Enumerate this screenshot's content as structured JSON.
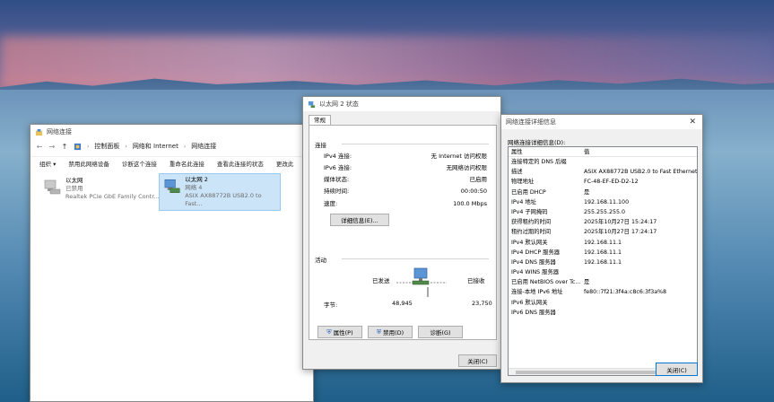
{
  "explorer": {
    "title": "网络连接",
    "breadcrumb": [
      "控制面板",
      "网络和 Internet",
      "网络连接"
    ],
    "toolbar": [
      "组织 ▾",
      "禁用此网络设备",
      "诊断这个连接",
      "重命名此连接",
      "查看此连接的状态",
      "更改此"
    ],
    "adapters": [
      {
        "name": "以太网",
        "status": "已禁用",
        "device": "Realtek PCIe GbE Family Contr..."
      },
      {
        "name": "以太网 2",
        "status": "网络 4",
        "device": "ASIX AX88772B USB2.0 to Fast..."
      }
    ]
  },
  "status_dialog": {
    "title": "以太网 2 状态",
    "tab": "常规",
    "connection_label": "连接",
    "rows": [
      {
        "label": "IPv4 连接:",
        "value": "无 Internet 访问权限"
      },
      {
        "label": "IPv6 连接:",
        "value": "无网络访问权限"
      },
      {
        "label": "媒体状态:",
        "value": "已启用"
      },
      {
        "label": "持续时间:",
        "value": "00:00:50"
      },
      {
        "label": "速度:",
        "value": "100.0 Mbps"
      }
    ],
    "details_button": "详细信息(E)...",
    "activity_label": "活动",
    "sent_label": "已发送",
    "received_label": "已接收",
    "bytes_label": "字节:",
    "bytes_sent": "48,945",
    "bytes_received": "23,750",
    "properties_button": "属性(P)",
    "disable_button": "禁用(D)",
    "diagnose_button": "诊断(G)",
    "close_button": "关闭(C)"
  },
  "details_dialog": {
    "title": "网络连接详细信息",
    "heading": "网络连接详细信息(D):",
    "col_property": "属性",
    "col_value": "值",
    "rows": [
      {
        "p": "连接特定的 DNS 后缀",
        "v": ""
      },
      {
        "p": "描述",
        "v": "ASIX AX88772B USB2.0 to Fast Ethernet"
      },
      {
        "p": "物理地址",
        "v": "FC-48-EF-ED-D2-12"
      },
      {
        "p": "已启用 DHCP",
        "v": "是"
      },
      {
        "p": "IPv4 地址",
        "v": "192.168.11.100"
      },
      {
        "p": "IPv4 子网掩码",
        "v": "255.255.255.0"
      },
      {
        "p": "获得租约的时间",
        "v": "2025年10月27日 15:24:17"
      },
      {
        "p": "租约过期的时间",
        "v": "2025年10月27日 17:24:17"
      },
      {
        "p": "IPv4 默认网关",
        "v": "192.168.11.1"
      },
      {
        "p": "IPv4 DHCP 服务器",
        "v": "192.168.11.1"
      },
      {
        "p": "IPv4 DNS 服务器",
        "v": "192.168.11.1"
      },
      {
        "p": "IPv4 WINS 服务器",
        "v": ""
      },
      {
        "p": "已启用 NetBIOS over Tc...",
        "v": "是"
      },
      {
        "p": "连接-本地 IPv6 地址",
        "v": "fe80::7f21:3f4a:c8c6:3f3a%8"
      },
      {
        "p": "IPv6 默认网关",
        "v": ""
      },
      {
        "p": "IPv6 DNS 服务器",
        "v": ""
      }
    ],
    "close_button": "关闭(C)"
  }
}
